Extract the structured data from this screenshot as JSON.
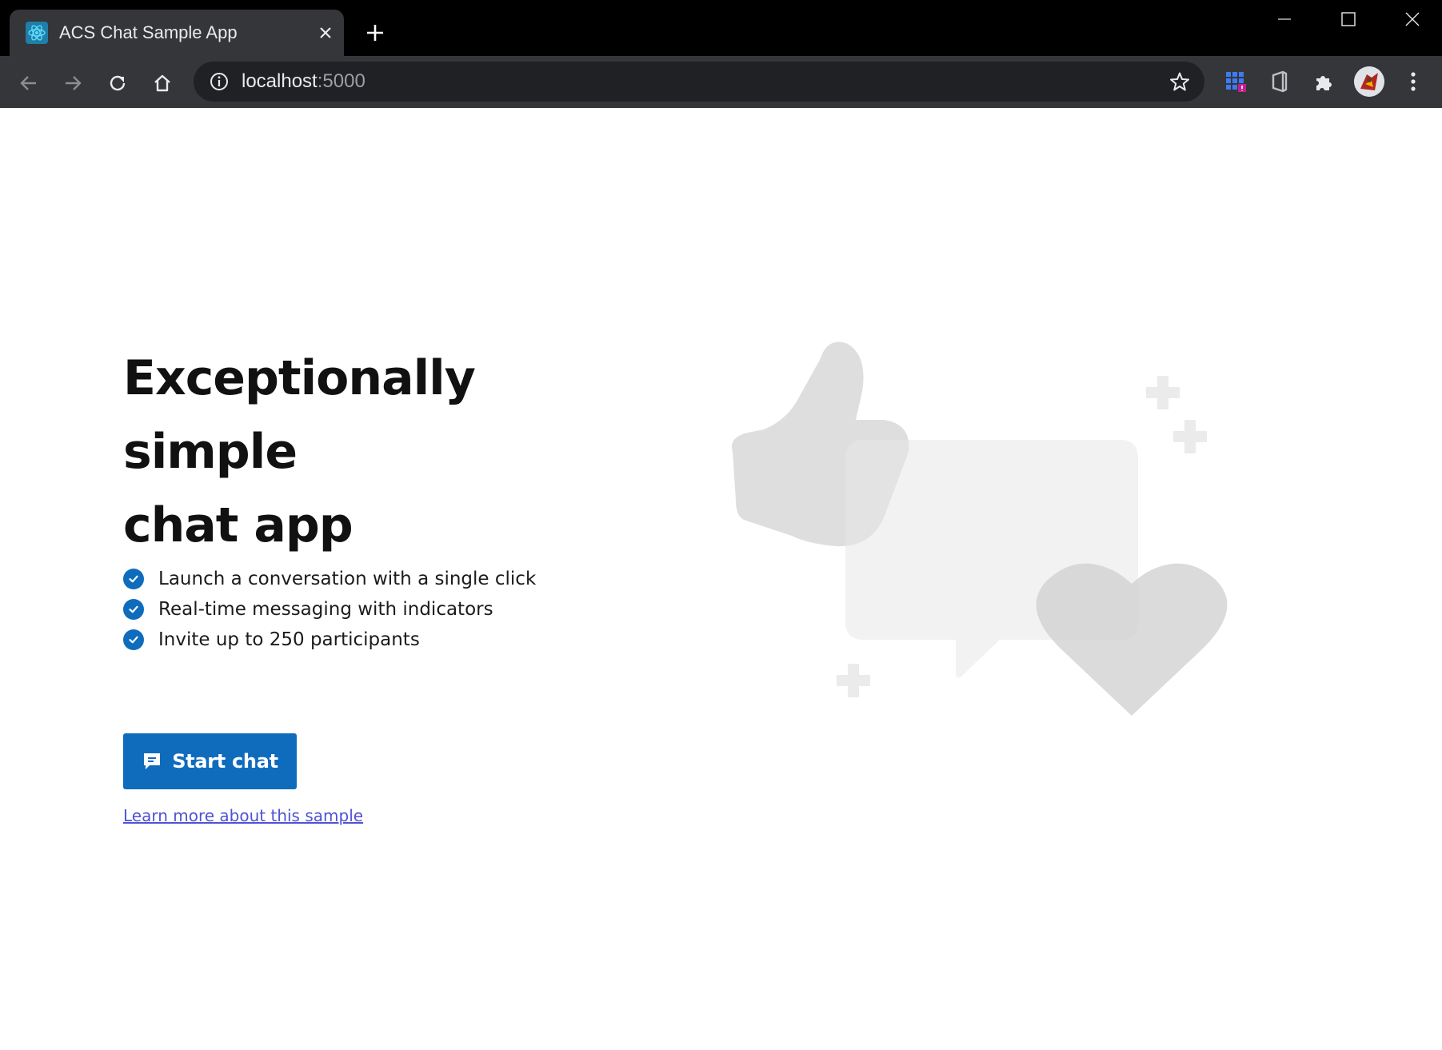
{
  "browser": {
    "tab": {
      "title": "ACS Chat Sample App",
      "favicon": "react-atom-icon"
    },
    "url": {
      "host": "localhost",
      "port": ":5000"
    },
    "colors": {
      "chrome": "#35363a",
      "tabstrip": "#000000",
      "omnibox": "#202124",
      "text": "#e8eaed",
      "port": "#9aa0a6"
    }
  },
  "page": {
    "title_line1": "Exceptionally simple",
    "title_line2": "chat app",
    "features": [
      "Launch a conversation with a single click",
      "Real-time messaging with indicators",
      "Invite up to 250 participants"
    ],
    "start_button": "Start chat",
    "learn_more": "Learn more about this sample",
    "illustration": [
      "thumbs-up-icon",
      "chat-bubble-icon",
      "heart-icon",
      "plus-sparkle-icon"
    ],
    "colors": {
      "accent": "#0f6cbd",
      "link": "#4f52d6",
      "illustration": "#dcdcdc"
    }
  }
}
